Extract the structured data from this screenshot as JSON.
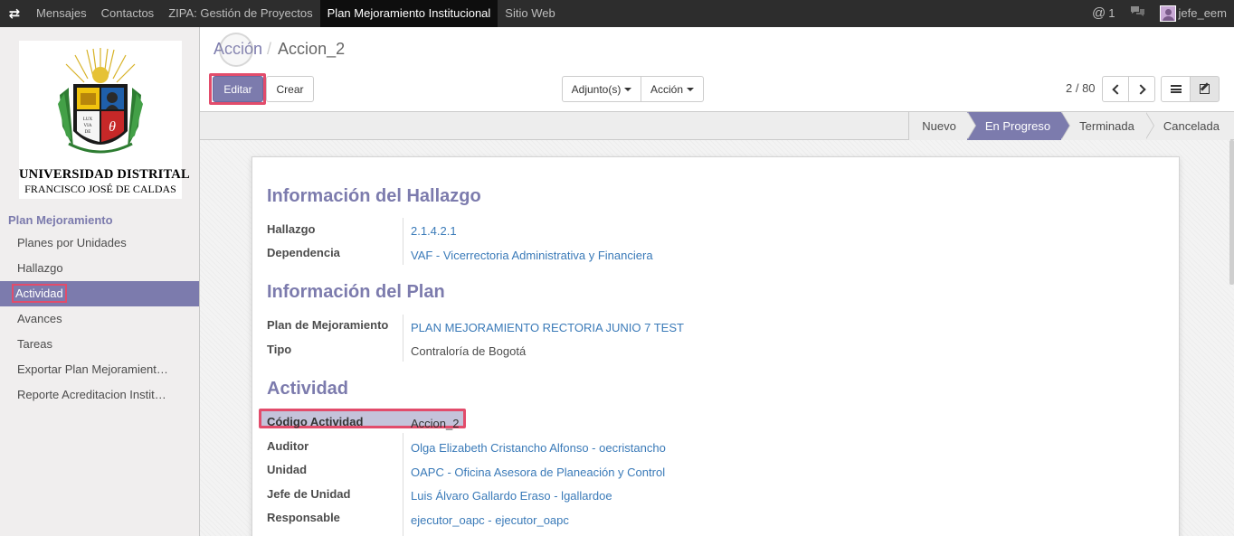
{
  "topbar": {
    "apps_icon": "switch-arrows-icon",
    "menu": [
      {
        "label": "Mensajes"
      },
      {
        "label": "Contactos"
      },
      {
        "label": "ZIPA: Gestión de Proyectos"
      },
      {
        "label": "Plan Mejoramiento Institucional",
        "active": true
      },
      {
        "label": "Sitio Web"
      }
    ],
    "notifications_count": "1",
    "user_name": "jefe_eem"
  },
  "logo": {
    "line1": "UNIVERSIDAD DISTRITAL",
    "line2": "FRANCISCO JOSÉ DE CALDAS"
  },
  "sidebar": {
    "section_title": "Plan Mejoramiento",
    "items": [
      {
        "label": "Planes por Unidades"
      },
      {
        "label": "Hallazgo"
      },
      {
        "label": "Actividad",
        "active": true
      },
      {
        "label": "Avances"
      },
      {
        "label": "Tareas"
      },
      {
        "label": "Exportar Plan Mejoramient…"
      },
      {
        "label": "Reporte Acreditacion Instit…"
      }
    ]
  },
  "breadcrumb": {
    "parent": "Acción",
    "separator": "/",
    "current": "Accion_2"
  },
  "toolbar": {
    "edit_label": "Editar",
    "create_label": "Crear",
    "attachments_label": "Adjunto(s)",
    "action_label": "Acción",
    "pager": "2 / 80"
  },
  "statusbar": {
    "stages": [
      "Nuevo",
      "En Progreso",
      "Terminada",
      "Cancelada"
    ],
    "active_stage": "En Progreso"
  },
  "form": {
    "sections": [
      {
        "title": "Información del Hallazgo",
        "fields": [
          {
            "label": "Hallazgo",
            "value": "2.1.4.2.1",
            "link": true
          },
          {
            "label": "Dependencia",
            "value": "VAF - Vicerrectoria Administrativa y Financiera",
            "link": true
          }
        ]
      },
      {
        "title": "Información del Plan",
        "fields": [
          {
            "label": "Plan de Mejoramiento",
            "value": "PLAN MEJORAMIENTO RECTORIA JUNIO 7 TEST",
            "link": true
          },
          {
            "label": "Tipo",
            "value": "Contraloría de Bogotá",
            "link": false
          }
        ]
      },
      {
        "title": "Actividad",
        "fields": [
          {
            "label": "Código Actividad",
            "value": "Accion_2",
            "link": false
          },
          {
            "label": "Auditor",
            "value": "Olga Elizabeth Cristancho Alfonso - oecristancho",
            "link": true
          },
          {
            "label": "Unidad",
            "value": "OAPC - Oficina Asesora de Planeación y Control",
            "link": true
          },
          {
            "label": "Jefe de Unidad",
            "value": "Luis Álvaro Gallardo Eraso - lgallardoe",
            "link": true
          },
          {
            "label": "Responsable",
            "value": "ejecutor_oapc - ejecutor_oapc",
            "link": true
          }
        ]
      }
    ]
  },
  "colors": {
    "accent": "#7c7bad",
    "link": "#3a7ab8",
    "highlight": "#e24c6b",
    "topbar": "#2d2d2d"
  }
}
